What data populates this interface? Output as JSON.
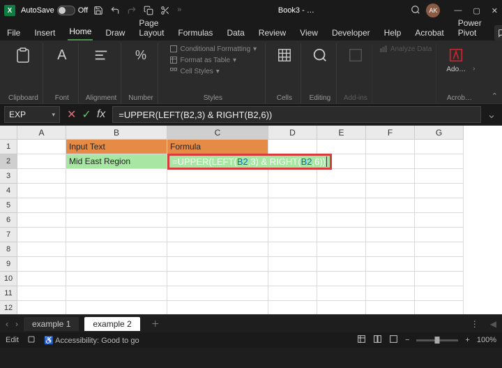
{
  "titlebar": {
    "autosave_label": "AutoSave",
    "autosave_state": "Off",
    "doc_name": "Book3 - …",
    "avatar": "AK"
  },
  "tabs": {
    "items": [
      "File",
      "Insert",
      "Home",
      "Draw",
      "Page Layout",
      "Formulas",
      "Data",
      "Review",
      "View",
      "Developer",
      "Help",
      "Acrobat",
      "Power Pivot"
    ],
    "active": "Home"
  },
  "ribbon": {
    "clipboard": "Clipboard",
    "font": "Font",
    "alignment": "Alignment",
    "number": "Number",
    "styles": "Styles",
    "cond_fmt": "Conditional Formatting",
    "as_table": "Format as Table",
    "cell_styles": "Cell Styles",
    "cells": "Cells",
    "editing": "Editing",
    "addins_lbl": "Add-ins",
    "analyze": "Analyze Data",
    "adobe": "Ado…",
    "acrobat_grp": "Acrob…"
  },
  "formula_bar": {
    "name_box": "EXP",
    "formula": "=UPPER(LEFT(B2,3)  &  RIGHT(B2,6))"
  },
  "grid": {
    "cols": [
      "A",
      "B",
      "C",
      "D",
      "E",
      "F",
      "G"
    ],
    "active_col": "C",
    "active_row": 2,
    "rows": 12,
    "b1": "Input Text",
    "c1": "Formula",
    "b2": "Mid East Region",
    "c2_pre": "=UPPER(LEFT(",
    "c2_b2a": "B2",
    "c2_mid": ",3)  & RIGHT(",
    "c2_b2b": "B2",
    "c2_suf": ",6))"
  },
  "sheets": {
    "tabs": [
      "example 1",
      "example 2"
    ],
    "active": "example 2"
  },
  "status": {
    "mode": "Edit",
    "accessibility": "Accessibility: Good to go",
    "zoom": "100%"
  }
}
